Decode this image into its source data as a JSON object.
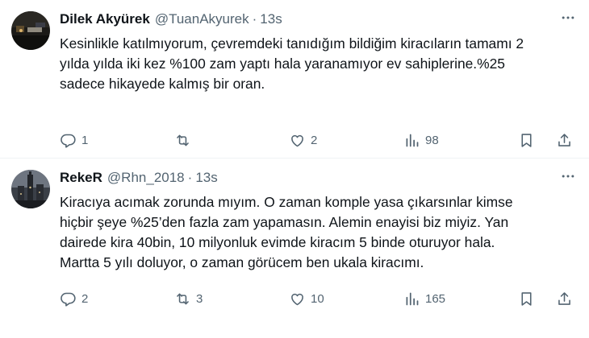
{
  "tweets": [
    {
      "name": "Dilek Akyürek",
      "handle": "@TuanAkyurek",
      "separator": "·",
      "time": "13s",
      "text": "Kesinlikle katılmıyorum, çevremdeki tanıdığım bildiğim kiracıların tamamı 2\nyılda yılda iki kez %100 zam yaptı hala yaranamıyor ev sahiplerine.%25\nsadece hikayede kalmış bir oran.",
      "replies": "1",
      "retweets": "",
      "likes": "2",
      "views": "98",
      "avatar_icon": "night-street-avatar"
    },
    {
      "name": "RekeR",
      "handle": "@Rhn_2018",
      "separator": "·",
      "time": "13s",
      "text": "Kiracıya acımak zorunda mıyım. O zaman komple yasa çıkarsınlar kimse\nhiçbir şeye %25’den fazla zam yapamasın. Alemin enayisi biz miyiz. Yan\ndairede kira 40bin, 10 milyonluk evimde kiracım 5 binde oturuyor hala.\nMartta 5 yılı doluyor, o zaman görücem ben ukala kiracımı.",
      "replies": "2",
      "retweets": "3",
      "likes": "10",
      "views": "165",
      "avatar_icon": "city-tower-avatar"
    }
  ],
  "icons": {
    "reply": "reply-icon",
    "retweet": "retweet-icon",
    "like": "heart-icon",
    "views": "views-icon",
    "bookmark": "bookmark-icon",
    "share": "share-icon",
    "more": "more-icon"
  },
  "colors": {
    "text": "#0f1419",
    "secondary": "#536471",
    "divider": "#eff3f4"
  }
}
